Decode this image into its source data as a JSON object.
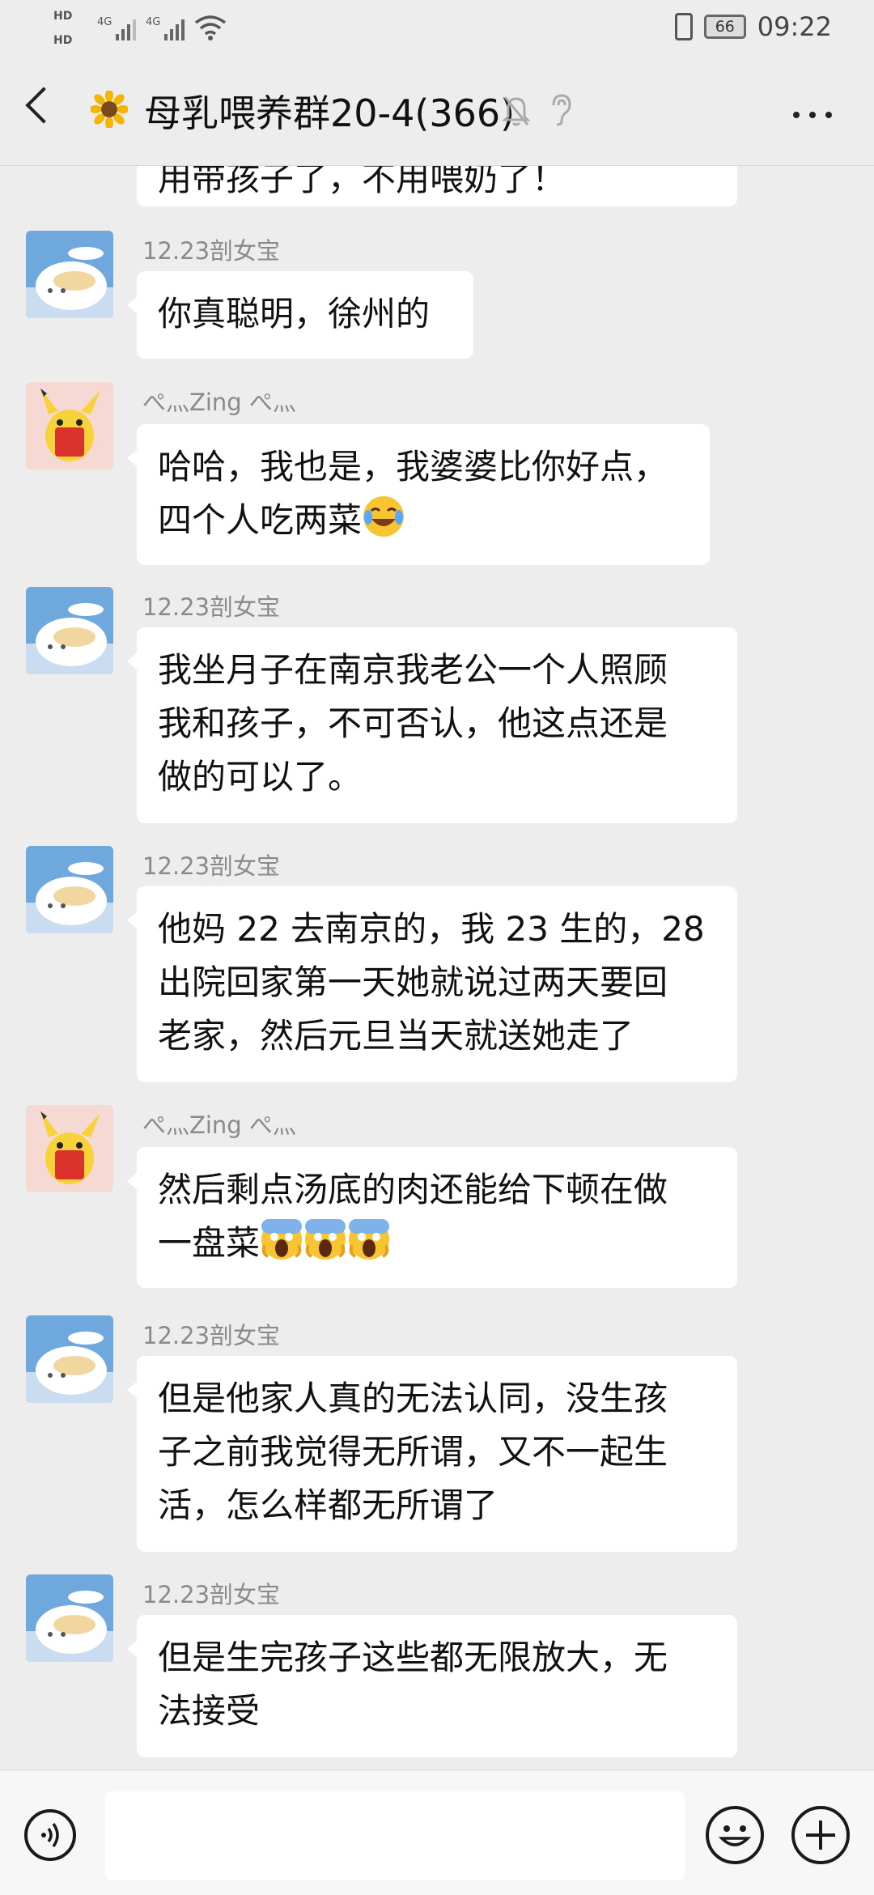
{
  "status": {
    "hd1": "HD",
    "hd2": "HD",
    "net1": "4G",
    "net2": "4G",
    "battery": "66",
    "time": "09:22"
  },
  "header": {
    "title": "母乳喂养群20-4(366)"
  },
  "chat": {
    "cropped_text": "用带孩子了，不用喂奶了！",
    "messages": [
      {
        "sender": "12.23剖女宝",
        "avatar": "cat-avatar",
        "lines": [
          "你真聪明，徐州的"
        ]
      },
      {
        "sender": "ぺ灬Zing ぺ灬",
        "avatar": "pikachu-avatar",
        "lines": [
          "哈哈，我也是，我婆婆比你好点，",
          "四个人吃两菜"
        ],
        "emoji": "laugh-cry"
      },
      {
        "sender": "12.23剖女宝",
        "avatar": "cat-avatar",
        "lines": [
          "我坐月子在南京我老公一个人照顾",
          "我和孩子，不可否认，他这点还是",
          "做的可以了。"
        ]
      },
      {
        "sender": "12.23剖女宝",
        "avatar": "cat-avatar",
        "lines": [
          "他妈 22 去南京的，我 23 生的，28",
          "出院回家第一天她就说过两天要回",
          "老家，然后元旦当天就送她走了"
        ]
      },
      {
        "sender": "ぺ灬Zing ぺ灬",
        "avatar": "pikachu-avatar",
        "lines": [
          "然后剩点汤底的肉还能给下顿在做",
          "一盘菜"
        ],
        "emoji": "scream"
      },
      {
        "sender": "12.23剖女宝",
        "avatar": "cat-avatar",
        "lines": [
          "但是他家人真的无法认同，没生孩",
          "子之前我觉得无所谓，又不一起生",
          "活，怎么样都无所谓了"
        ]
      },
      {
        "sender": "12.23剖女宝",
        "avatar": "cat-avatar",
        "lines": [
          "但是生完孩子这些都无限放大，无",
          "法接受"
        ]
      }
    ]
  },
  "input": {
    "placeholder": ""
  },
  "colors": {
    "background": "#ededed",
    "bubble": "#ffffff",
    "sender": "#8a8a8a"
  }
}
